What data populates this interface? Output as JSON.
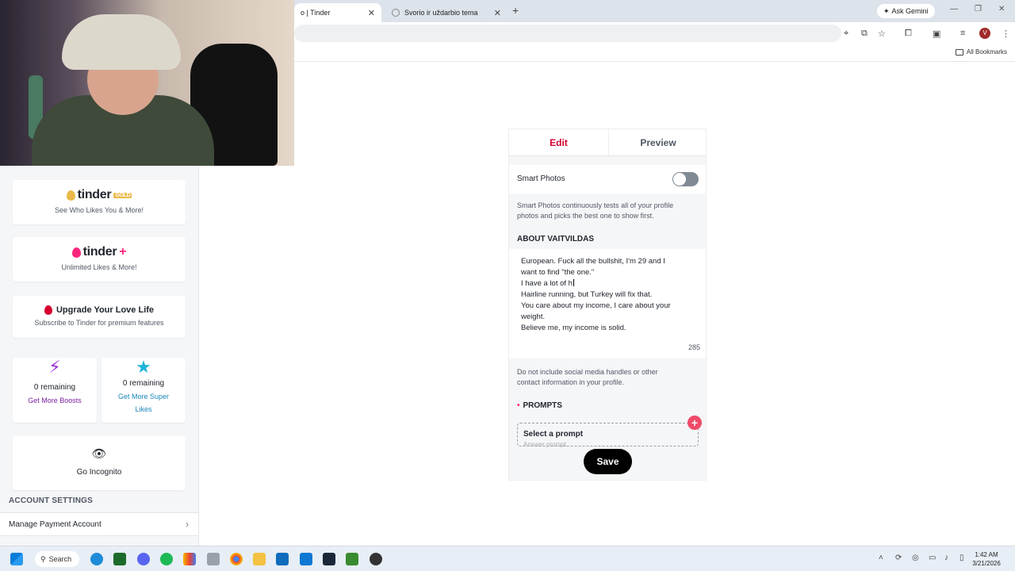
{
  "browser": {
    "tabs": [
      {
        "title": "o | Tinder",
        "active": true
      },
      {
        "title": "Svorio ir uždarbio tema",
        "active": false
      }
    ],
    "new_tab": "+",
    "tab_close": "✕",
    "ask_gemini": "Ask Gemini",
    "all_bookmarks": "All Bookmarks",
    "profile_initial": "V"
  },
  "sidebar": {
    "gold": {
      "logo": "tinder",
      "badge": "GOLD",
      "subtitle": "See Who Likes You & More!"
    },
    "plus": {
      "logo": "tinder",
      "plus": "+",
      "subtitle": "Unlimited Likes & More!"
    },
    "upgrade": {
      "title": "Upgrade Your Love Life",
      "subtitle": "Subscribe to Tinder for premium features"
    },
    "boosts": {
      "count": "0 remaining",
      "link": "Get More Boosts"
    },
    "super_likes": {
      "count": "0 remaining",
      "link_line1": "Get More Super",
      "link_line2": "Likes"
    },
    "incognito": {
      "label": "Go Incognito"
    },
    "account_settings": "ACCOUNT SETTINGS",
    "manage_payment": "Manage Payment Account"
  },
  "editor": {
    "tab_edit": "Edit",
    "tab_preview": "Preview",
    "smart_photos_label": "Smart Photos",
    "smart_photos_enabled": false,
    "smart_photos_desc_1": "Smart Photos continuously tests all of your profile",
    "smart_photos_desc_2": "photos and picks the best one to show first.",
    "about_heading": "ABOUT VAITVILDAS",
    "bio_lines": [
      "European. Fuck all the bullshit, I'm 29 and I",
      "want to find \"the one.\"",
      "I have a lot of h",
      "Hairline running, but Turkey will fix that.",
      "You care about my income, I care about your",
      "weight.",
      "Believe me, my income is solid."
    ],
    "char_count": "285",
    "warning_1": "Do not include social media handles or other",
    "warning_2": "contact information in your profile.",
    "prompts_heading": "PROMPTS",
    "prompt_title": "Select a prompt",
    "prompt_answer": "Answer prompt",
    "save_label": "Save"
  },
  "taskbar": {
    "search": "Search",
    "time": "1:42 AM",
    "date": "3/21/2026"
  },
  "colors": {
    "tinder_red": "#fd267d",
    "edit_accent": "#d6002f",
    "gold": "#e9b949",
    "boost_purple": "#7a1fa2",
    "superlike_blue": "#1a87b8"
  }
}
